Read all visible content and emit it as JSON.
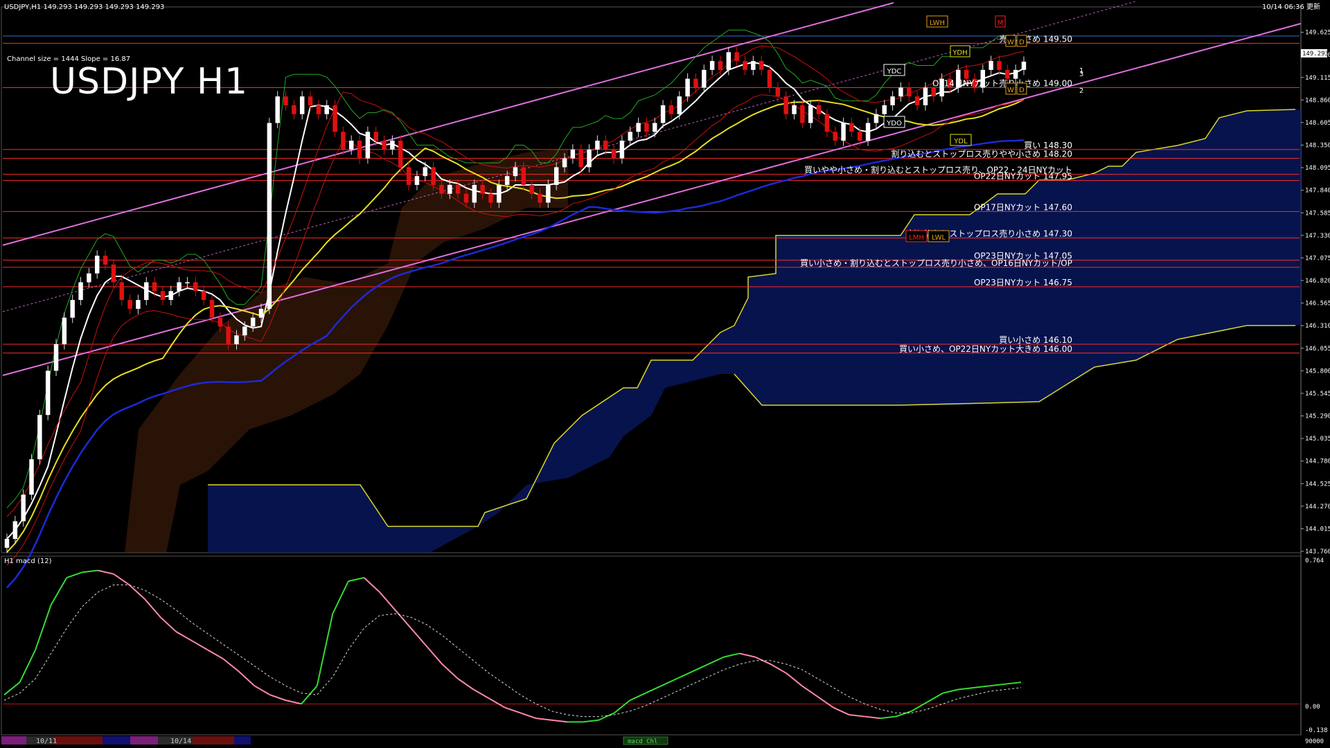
{
  "window": {
    "symbol_line": "USDJPY,H1  149.293 149.293 149.293 149.293",
    "timestamp": "10/14 06:36 更新",
    "big_title": "USDJPY H1",
    "channel_info": "Channel size = 1444 Slope = 16.87"
  },
  "price_axis": {
    "labels": [
      "149.625",
      "149.370",
      "149.115",
      "148.860",
      "148.605",
      "148.350",
      "148.095",
      "147.840",
      "147.585",
      "147.330",
      "147.075",
      "146.820",
      "146.565",
      "146.310",
      "146.055",
      "145.800",
      "145.545",
      "145.290",
      "145.035",
      "144.780",
      "144.525",
      "144.270",
      "144.015",
      "143.760"
    ],
    "current_price": "149.293",
    "ylim": [
      143.76,
      149.88
    ]
  },
  "macd": {
    "label": "H1  macd (12)",
    "axis_labels": [
      "0.764",
      "0.00",
      "-0.138"
    ],
    "ylim": [
      -0.16,
      0.8
    ],
    "bottom_label": "90000",
    "legend_tab": "macd Chl"
  },
  "date_bar": {
    "labels": [
      "10/11",
      "10/14"
    ]
  },
  "levels": [
    {
      "text": "売り小さめ 149.50",
      "price": 149.5,
      "color": "#ff2a2a"
    },
    {
      "text": "OP14日NYカット売り小さめ 149.00",
      "price": 149.0,
      "color": "#ff2a2a"
    },
    {
      "text": "買い 148.30",
      "price": 148.3,
      "color": "#ff2a2a"
    },
    {
      "text": "割り込むとストップロス売りやや小さめ 148.20",
      "price": 148.2,
      "color": "#ff2a2a"
    },
    {
      "text": "買いやや小さめ・割り込むとストップロス売り、OP22・24日NYカット",
      "price": 148.02,
      "color": "#ff2a2a"
    },
    {
      "text": "OP22日NYカット 147.95",
      "price": 147.95,
      "color": "#ff2a2a"
    },
    {
      "text": "OP17日NYカット 147.60",
      "price": 147.6,
      "color": "#ff2a2a"
    },
    {
      "text": "割り込むとストップロス売り小さめ 147.30",
      "price": 147.3,
      "color": "#ff2a2a"
    },
    {
      "text": "OP23日NYカット 147.05",
      "price": 147.05,
      "color": "#ff2a2a"
    },
    {
      "text": "買い小さめ・割り込むとストップロス売り小さめ、OP16日NYカット/OP",
      "price": 146.97,
      "color": "#ff2a2a"
    },
    {
      "text": "OP23日NYカット 146.75",
      "price": 146.75,
      "color": "#ff2a2a"
    },
    {
      "text": "買い小さめ 146.10",
      "price": 146.1,
      "color": "#ff2a2a"
    },
    {
      "text": "買い小さめ、OP22日NYカット大きめ 146.00",
      "price": 146.0,
      "color": "#ff2a2a"
    }
  ],
  "markers": {
    "ydh": "YDH",
    "ydl": "YDL",
    "ydc": "YDC",
    "ydo": "YDO",
    "lwh": "LWH",
    "lwl": "LWL",
    "lmh": "LMH",
    "w": "W",
    "d": "D",
    "m": "M",
    "n1": "1",
    "n3": "3",
    "n2": "2"
  },
  "chart_data": {
    "type": "line",
    "title": "USDJPY H1",
    "x_count": 125,
    "close": [
      143.9,
      144.1,
      144.4,
      144.8,
      145.3,
      145.8,
      146.1,
      146.4,
      146.6,
      146.8,
      146.9,
      147.1,
      147.0,
      146.8,
      146.6,
      146.5,
      146.6,
      146.8,
      146.7,
      146.6,
      146.7,
      146.8,
      146.8,
      146.7,
      146.6,
      146.4,
      146.3,
      146.1,
      146.2,
      146.3,
      146.4,
      146.5,
      148.6,
      148.9,
      148.8,
      148.7,
      148.9,
      148.8,
      148.7,
      148.8,
      148.5,
      148.3,
      148.4,
      148.2,
      148.5,
      148.4,
      148.3,
      148.4,
      148.1,
      147.9,
      148.0,
      148.1,
      147.9,
      147.8,
      147.9,
      147.8,
      147.7,
      147.9,
      147.8,
      147.7,
      147.9,
      148.0,
      148.1,
      147.9,
      147.8,
      147.7,
      147.9,
      148.1,
      148.2,
      148.3,
      148.1,
      148.3,
      148.4,
      148.3,
      148.2,
      148.4,
      148.5,
      148.6,
      148.5,
      148.6,
      148.8,
      148.7,
      148.9,
      149.1,
      149.0,
      149.2,
      149.3,
      149.2,
      149.4,
      149.3,
      149.2,
      149.3,
      149.2,
      149.0,
      148.9,
      148.7,
      148.8,
      148.6,
      148.8,
      148.7,
      148.5,
      148.4,
      148.6,
      148.5,
      148.4,
      148.6,
      148.7,
      148.8,
      148.9,
      149.0,
      148.9,
      148.8,
      149.0,
      148.9,
      149.1,
      149.0,
      149.2,
      149.1,
      149.0,
      149.2,
      149.3,
      149.2,
      149.1,
      149.2,
      149.293
    ],
    "macd": [
      0.05,
      0.12,
      0.3,
      0.55,
      0.7,
      0.73,
      0.74,
      0.72,
      0.66,
      0.58,
      0.48,
      0.4,
      0.35,
      0.3,
      0.25,
      0.18,
      0.1,
      0.05,
      0.02,
      0.0,
      0.1,
      0.5,
      0.68,
      0.7,
      0.62,
      0.52,
      0.42,
      0.32,
      0.22,
      0.14,
      0.08,
      0.03,
      -0.02,
      -0.05,
      -0.08,
      -0.09,
      -0.1,
      -0.1,
      -0.09,
      -0.05,
      0.02,
      0.06,
      0.1,
      0.14,
      0.18,
      0.22,
      0.26,
      0.28,
      0.26,
      0.22,
      0.17,
      0.1,
      0.04,
      -0.02,
      -0.06,
      -0.07,
      -0.08,
      -0.07,
      -0.04,
      0.01,
      0.06,
      0.08,
      0.09,
      0.1,
      0.11,
      0.12
    ],
    "signal": [
      0.02,
      0.06,
      0.14,
      0.28,
      0.42,
      0.54,
      0.62,
      0.66,
      0.66,
      0.63,
      0.58,
      0.52,
      0.45,
      0.39,
      0.33,
      0.27,
      0.21,
      0.15,
      0.1,
      0.06,
      0.05,
      0.15,
      0.3,
      0.42,
      0.49,
      0.5,
      0.48,
      0.44,
      0.38,
      0.31,
      0.24,
      0.17,
      0.11,
      0.05,
      0.0,
      -0.04,
      -0.06,
      -0.07,
      -0.07,
      -0.06,
      -0.04,
      -0.01,
      0.03,
      0.07,
      0.11,
      0.15,
      0.19,
      0.22,
      0.24,
      0.24,
      0.22,
      0.19,
      0.14,
      0.09,
      0.04,
      0.0,
      -0.03,
      -0.05,
      -0.05,
      -0.03,
      0.0,
      0.03,
      0.05,
      0.07,
      0.08,
      0.09
    ]
  }
}
